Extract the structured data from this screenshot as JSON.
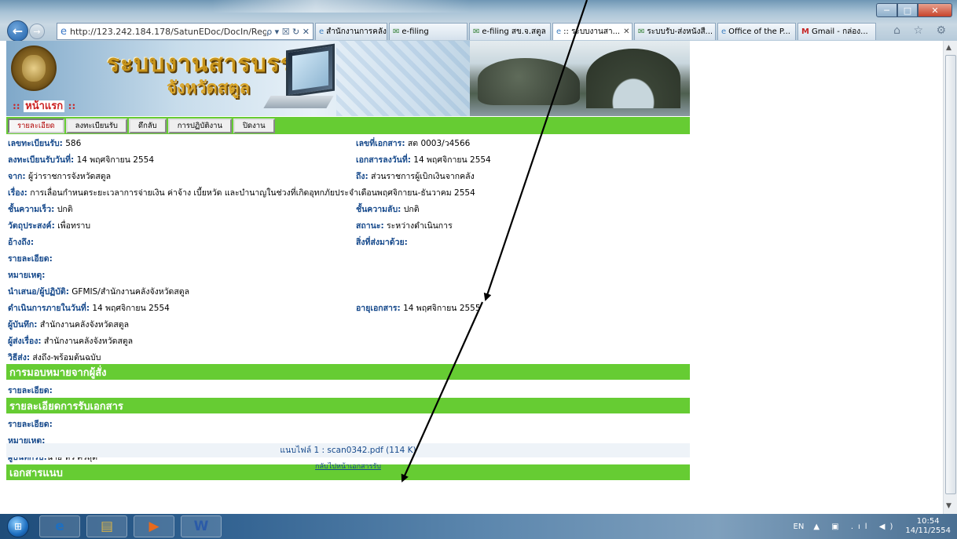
{
  "browser": {
    "url": "http://123.242.184.178/SatunEDoc/DocIn/Regist",
    "address_tools": "ρ ▾ ☒ ↻ ✕",
    "tabs": [
      {
        "label": "สำนักงานการคลัง...",
        "icon": "ie-page-icon",
        "active": false
      },
      {
        "label": "e-filing",
        "icon": "mail-icon",
        "active": false
      },
      {
        "label": "e-filing สข.จ.สตูล",
        "icon": "mail-icon",
        "active": false
      },
      {
        "label": ":: ระบบงานสา...",
        "icon": "ie-page-icon",
        "active": true
      },
      {
        "label": "ระบบรับ-ส่งหนังสื...",
        "icon": "mail-icon",
        "active": false
      },
      {
        "label": "Office of the P...",
        "icon": "ie-page-icon",
        "active": false
      },
      {
        "label": "Gmail - กล่อง...",
        "icon": "gmail-icon",
        "active": false
      }
    ],
    "browser_icons": "⌂ ☆ ⚙"
  },
  "header": {
    "title_line1": "ระบบงานสารบรรณ",
    "title_line2": "จังหวัดสตูล",
    "home_label": "หน้าแรก",
    "home_dots_left": "::",
    "home_dots_right": "::"
  },
  "nav": {
    "items": [
      {
        "label": "รายละเอียด",
        "active": true
      },
      {
        "label": "ลงทะเบียนรับ",
        "active": false
      },
      {
        "label": "ดึกลับ",
        "active": false
      },
      {
        "label": "การปฏิบัติงาน",
        "active": false
      },
      {
        "label": "ปิดงาน",
        "active": false
      }
    ]
  },
  "details": {
    "reg_no_label": "เลขทะเบียนรับ:",
    "reg_no": "586",
    "doc_no_label": "เลขที่เอกสาร:",
    "doc_no": "สต 0003/ว4566",
    "reg_date_label": "ลงทะเบียนรับวันที่:",
    "reg_date": "14 พฤศจิกายน  2554",
    "doc_date_label": "เอกสารลงวันที่:",
    "doc_date": "14 พฤศจิกายน  2554",
    "from_label": "จาก:",
    "from": "ผู้ว่าราชการจังหวัดสตูล",
    "to_label": "ถึง:",
    "to": "ส่วนราชการผู้เบิกเงินจากคลัง",
    "subject_label": "เรื่อง:",
    "subject": "การเลื่อนกำหนดระยะเวลาการจ่ายเงิน  ค่าจ้าง  เบี้ยหวัด  และบำนาญในช่วงที่เกิดอุทกภัยประจำเดือนพฤศจิกายน-ธันวาคม  2554",
    "speed_label": "ชั้นความเร็ว:",
    "speed": "ปกติ",
    "secret_label": "ชั้นความลับ:",
    "secret": "ปกติ",
    "purpose_label": "วัตถุประสงค์:",
    "purpose": "เพื่อทราบ",
    "status_label": "สถานะ:",
    "status": "ระหว่างดำเนินการ",
    "ref_label": "อ้างถึง:",
    "ref": "",
    "enclosure_label": "สิ่งที่ส่งมาด้วย:",
    "enclosure": "",
    "detail_label": "รายละเอียด:",
    "remark_label": "หมายเหตุ:",
    "proposer_label": "นำเสนอ/ผู้ปฏิบัติ:",
    "proposer": "GFMIS/สำนักงานคลังจังหวัดสตูล",
    "due_label": "ดำเนินการภายในวันที่:",
    "due": "14 พฤศจิกายน  2554",
    "expire_label": "อายุเอกสาร:",
    "expire": "14 พฤศจิกายน  2555",
    "recorder_label": "ผู้บันทึก:",
    "recorder": "สำนักงานคลังจังหวัดสตูล",
    "owner_label": "ผู้ส่งเรื่อง:",
    "owner": "สำนักงานคลังจังหวัดสตูล",
    "method_label": "วิธีส่ง:",
    "method": "ส่งถึง-พร้อมต้นฉบับ"
  },
  "assign": {
    "title": "การมอบหมายจากผู้สั่ง",
    "detail_label": "รายละเอียด:"
  },
  "receive": {
    "title": "รายละเอียดการรับเอกสาร",
    "detail_label": "รายละเอียด:",
    "remark_label": "หมายเหตุ:",
    "receiver_label": "ผู้บันทึกรับ:",
    "receiver": "นาย  หั้ว  ศรีสุด"
  },
  "attach": {
    "title": "เอกสารแนบ",
    "prefix": "แนบไฟล์  1 : ",
    "file_link": "scan0342.pdf (114 K)",
    "back_link": "กลับไปหน้าเอกสารรับ"
  },
  "taskbar": {
    "lang": "EN",
    "tray_icons": "▲ ▣ .ıl ◀)",
    "time": "10:54",
    "date": "14/11/2554"
  },
  "window": {
    "minimize": "─",
    "maximize": "□",
    "close": "✕"
  }
}
